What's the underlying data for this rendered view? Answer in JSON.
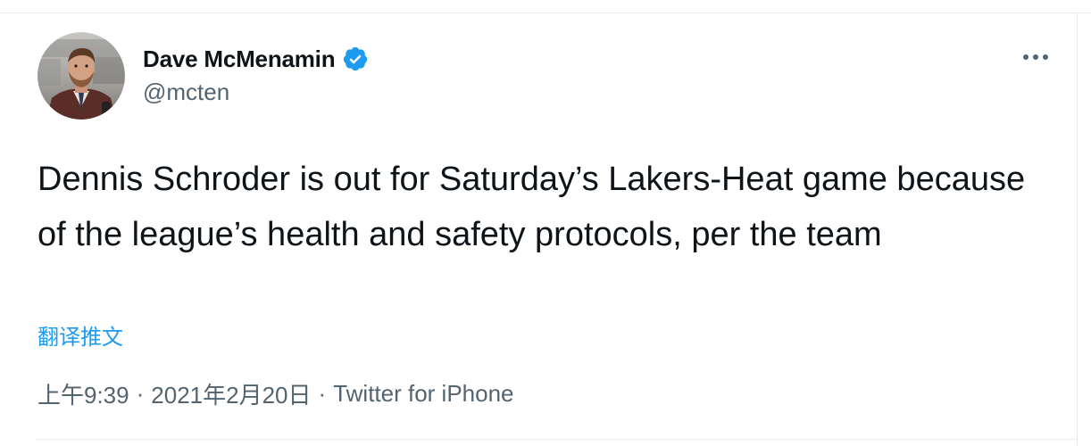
{
  "author": {
    "name": "Dave McMenamin",
    "handle": "@mcten",
    "verified": true,
    "verified_color": "#1d9bf0"
  },
  "tweet": {
    "text": "Dennis Schroder is out for Saturday’s Lakers-Heat game because of the league’s health and safety protocols, per the team",
    "translate_label": "翻译推文"
  },
  "meta": {
    "time": "上午9:39",
    "separator": "·",
    "date": "2021年2月20日",
    "source": "Twitter for iPhone"
  },
  "icons": {
    "verified": "verified-badge-icon",
    "more": "more-horizontal-icon"
  },
  "colors": {
    "text": "#0f1419",
    "secondary": "#536471",
    "link": "#1d9bf0",
    "border": "#e6ecf0"
  }
}
